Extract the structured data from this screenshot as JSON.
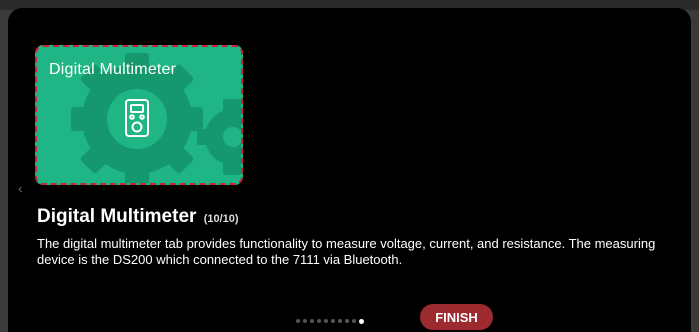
{
  "card": {
    "title": "Digital Multimeter",
    "icon": "multimeter-icon",
    "accent": "#1fb585",
    "border_color": "#c8243a"
  },
  "step": {
    "title": "Digital Multimeter",
    "count": "(10/10)",
    "description": "The digital multimeter tab provides functionality to measure voltage, current, and resistance. The measuring device is the DS200 which connected to the 7111 via Bluetooth."
  },
  "pagination": {
    "total": 10,
    "current": 10
  },
  "finish_label": "FINISH",
  "colors": {
    "finish_button": "#9c2a2e",
    "dialog_bg": "#000000"
  }
}
